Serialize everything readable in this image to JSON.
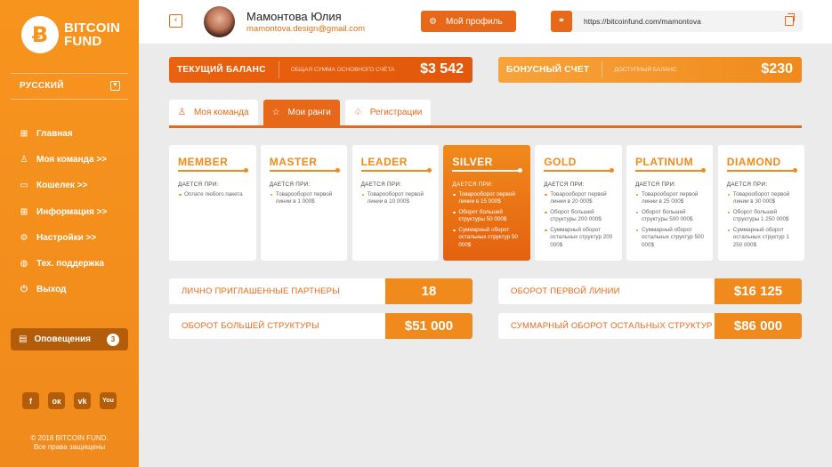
{
  "sidebar": {
    "logo_symbol": "Ƀ",
    "logo_line1": "BITCOIN",
    "logo_line2": "FUND",
    "language": "РУССКИЙ",
    "nav": [
      {
        "label": "Главная",
        "icon": "grid-icon"
      },
      {
        "label": "Моя команда >>",
        "icon": "user-icon"
      },
      {
        "label": "Кошелек >>",
        "icon": "wallet-icon"
      },
      {
        "label": "Информация >>",
        "icon": "info-grid-icon"
      },
      {
        "label": "Настройки >>",
        "icon": "settings-icon"
      },
      {
        "label": "Тех. поддержка",
        "icon": "globe-icon"
      },
      {
        "label": "Выход",
        "icon": "power-icon"
      }
    ],
    "notifications_label": "Оповещения",
    "notifications_count": "3",
    "socials": [
      {
        "name": "facebook-icon",
        "glyph": "f"
      },
      {
        "name": "odnoklassniki-icon",
        "glyph": "ок"
      },
      {
        "name": "vk-icon",
        "glyph": "vk"
      },
      {
        "name": "youtube-icon",
        "glyph": "You"
      }
    ],
    "copyright_line1": "© 2018 BITCOIN FUND.",
    "copyright_line2": "Все права защищены"
  },
  "header": {
    "user_name": "Мамонтова Юлия",
    "user_email": "mamontova.design@gmail.com",
    "profile_button": "Мой профиль",
    "referral_url": "https://bitcoinfund.com/mamontova"
  },
  "balances": {
    "main_title": "ТЕКУЩИЙ БАЛАНС",
    "main_subtitle": "общая сумма основного счёта",
    "main_value": "$3 542",
    "bonus_title": "БОНУСНЫЙ СЧЕТ",
    "bonus_subtitle": "доступный баланс",
    "bonus_value": "$230"
  },
  "tabs": [
    {
      "label": "Моя команда",
      "active": false
    },
    {
      "label": "Мои ранги",
      "active": true
    },
    {
      "label": "Регистрации",
      "active": false
    }
  ],
  "ranks": [
    {
      "name": "MEMBER",
      "condition": "ДАЕТСЯ ПРИ:",
      "reqs": [
        "Оплате любого пакета"
      ]
    },
    {
      "name": "MASTER",
      "condition": "ДАЕТСЯ ПРИ:",
      "reqs": [
        "Товарооборот первой линии в 1 000$"
      ]
    },
    {
      "name": "LEADER",
      "condition": "ДАЕТСЯ ПРИ:",
      "reqs": [
        "Товарооборот первой линии в 10 000$"
      ]
    },
    {
      "name": "SILVER",
      "condition": "ДАЕТСЯ ПРИ:",
      "reqs": [
        "Товарооборот первой линии в 15 000$",
        "Оборот большей структуры 50 000$",
        "Суммарный оборот остальных структур 50 000$"
      ]
    },
    {
      "name": "GOLD",
      "condition": "ДАЕТСЯ ПРИ:",
      "reqs": [
        "Товарооборот первой линии в 20 000$",
        "Оборот большей структуры 200 000$",
        "Суммарный оборот остальных структур 200 000$"
      ]
    },
    {
      "name": "PLATINUM",
      "condition": "ДАЕТСЯ ПРИ:",
      "reqs": [
        "Товарооборот первой линии в 25 000$",
        "Оборот большей структуры 500 000$",
        "Суммарный оборот остальных структур 500 000$"
      ]
    },
    {
      "name": "DIAMOND",
      "condition": "ДАЕТСЯ ПРИ:",
      "reqs": [
        "Товарооборот первой линии в 30 000$",
        "Оборот большей структуры 1 250 000$",
        "Суммарный оборот остальных структур 1 250 000$"
      ]
    }
  ],
  "active_rank": "SILVER",
  "stats": [
    {
      "label": "ЛИЧНО ПРИГЛАШЕННЫЕ ПАРТНЕРЫ",
      "value": "18"
    },
    {
      "label": "ОБОРОТ ПЕРВОЙ ЛИНИИ",
      "value": "$16 125"
    },
    {
      "label": "ОБОРОТ БОЛЬШЕЙ СТРУКТУРЫ",
      "value": "$51 000"
    },
    {
      "label": "СУММАРНЫЙ ОБОРОТ ОСТАЛЬНЫХ СТРУКТУР",
      "value": "$86 000"
    }
  ],
  "colors": {
    "accent": "#e8681a",
    "accent_light": "#f08a1c",
    "sidebar": "#f7941d",
    "sidebar_dark": "#b35d0a"
  }
}
